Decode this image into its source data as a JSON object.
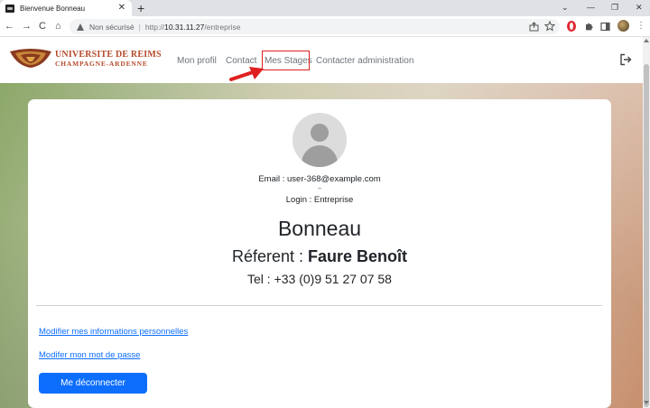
{
  "browser": {
    "tab_title": "Bienvenue Bonneau",
    "tab_close": "✕",
    "new_tab": "+",
    "back": "←",
    "forward": "→",
    "reload": "C",
    "home": "⌂",
    "security_label": "Non sécurisé",
    "url_scheme": "http://",
    "url_host": "10.31.11.27",
    "url_path": "/entreprise",
    "minimize": "—",
    "restore": "❐",
    "close": "✕",
    "collapse": "⌄",
    "menu": "⋮"
  },
  "site": {
    "logo_line1": "UNIVERSITE DE REIMS",
    "logo_line2": "CHAMPAGNE-ARDENNE",
    "nav": {
      "profile": "Mon profil",
      "contact": "Contact",
      "stages": "Mes Stages",
      "admin": "Contacter administration"
    }
  },
  "profile": {
    "email": "Email : user-368@example.com",
    "dash": "–",
    "login": "Login : Entreprise",
    "name": "Bonneau",
    "referent_label": "Réferent : ",
    "referent_name": "Faure Benoît",
    "tel": "Tel : +33 (0)9 51 27 07 58"
  },
  "actions": {
    "edit_info": "Modifier mes informations personnelles",
    "edit_password": "Modifer mon mot de passe",
    "logout": "Me déconnecter"
  },
  "colors": {
    "primary": "#0d6efd",
    "logo": "#b44a2a",
    "highlight": "#e02020"
  }
}
